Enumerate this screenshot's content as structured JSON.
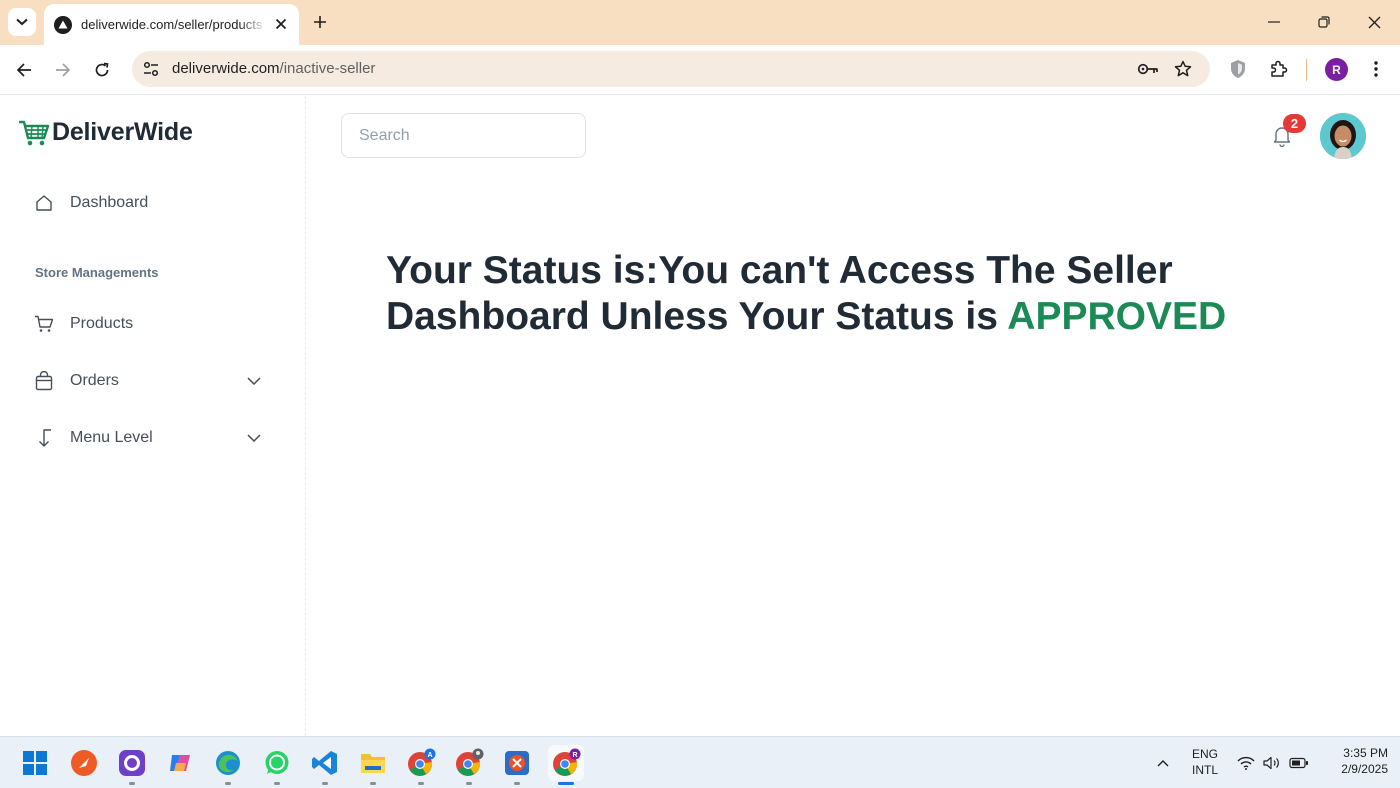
{
  "browser": {
    "tab_title": "deliverwide.com/seller/products",
    "url_host": "deliverwide.com",
    "url_path": "/inactive-seller",
    "profile_initial": "R"
  },
  "app": {
    "logo_text": "DeliverWide",
    "brand_color": "#1b8a55",
    "sidebar": {
      "items": [
        {
          "label": "Dashboard",
          "icon": "home-icon"
        },
        {
          "label": "Products",
          "icon": "cart-icon"
        },
        {
          "label": "Orders",
          "icon": "bag-icon",
          "expandable": true
        },
        {
          "label": "Menu Level",
          "icon": "level-down-icon",
          "expandable": true
        }
      ],
      "section_title": "Store Managements"
    },
    "header": {
      "search_placeholder": "Search",
      "notification_count": "2"
    },
    "main": {
      "status_text": "Your Status is:You can't Access The Seller Dashboard Unless Your Status is ",
      "status_highlight": "APPROVED"
    }
  },
  "taskbar": {
    "apps": [
      "start",
      "postman",
      "github-desktop",
      "copilot",
      "edge",
      "whatsapp",
      "vscode",
      "file-explorer",
      "chrome-profile-a",
      "chrome-profile-2",
      "remote-desktop",
      "chrome-profile-r"
    ],
    "lang_top": "ENG",
    "lang_bottom": "INTL",
    "time": "3:35 PM",
    "date": "2/9/2025"
  }
}
